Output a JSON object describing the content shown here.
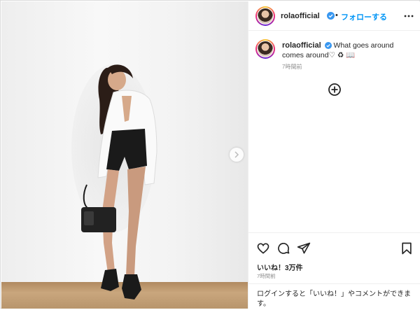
{
  "post": {
    "username": "rolaofficial",
    "separator": "•",
    "follow_label": "フォローする",
    "caption_text": "What goes around comes around♡ ♻ 📖",
    "caption_time": "7時間前",
    "likes": "いいね！3万件",
    "posted_ago": "7時間前",
    "login_prompt": "ログインすると「いいね！」やコメントができます。"
  },
  "icons": {
    "verified": "verified-badge-icon",
    "more": "more-options-icon",
    "add": "add-circle-icon",
    "like": "heart-icon",
    "comment": "comment-icon",
    "share": "share-icon",
    "save": "bookmark-icon",
    "next": "chevron-right-icon"
  },
  "colors": {
    "link_blue": "#0095f6",
    "verified_blue": "#3897f0",
    "muted_text": "#8e8e8e"
  }
}
